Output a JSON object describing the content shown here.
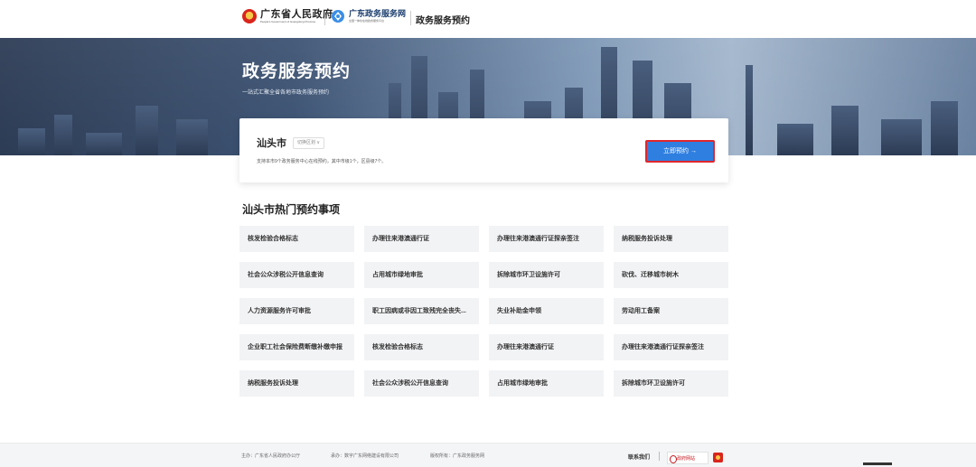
{
  "header": {
    "gov_name": "广东省人民政府",
    "gov_name_en": "People's Government of Guangdong Province",
    "portal_name": "广东政务服务网",
    "portal_sub": "全国一体化在线政务服务平台",
    "site_name": "政务服务预约"
  },
  "banner": {
    "title": "政务服务预约",
    "subtitle": "一站式汇聚全省各地市政务服务预约"
  },
  "city_card": {
    "city": "汕头市",
    "switch_label": "切换区划 ∨",
    "description": "支持本市9个政务服务中心在线预约，其中市级1个，区县级7个。",
    "book_button": "立即预约  →"
  },
  "hot_section": {
    "title": "汕头市热门预约事项",
    "items": [
      "核发检验合格标志",
      "办理往来港澳通行证",
      "办理往来港澳通行证探亲签注",
      "纳税服务投诉处理",
      "社会公众涉税公开信息查询",
      "占用城市绿地审批",
      "拆除城市环卫设施许可",
      "砍伐、迁移城市树木",
      "人力资源服务许可审批",
      "职工因病或非因工致残完全丧失...",
      "失业补助金申领",
      "劳动用工备案",
      "企业职工社会保险费断缴补缴申报",
      "核发检验合格标志",
      "办理往来港澳通行证",
      "办理往来港澳通行证探亲签注",
      "纳税服务投诉处理",
      "社会公众涉税公开信息查询",
      "占用城市绿地审批",
      "拆除城市环卫设施许可"
    ]
  },
  "footer": {
    "sponsor": "主办：广东省人民政府办公厅",
    "builder": "承办：数字广东网络建设有限公司",
    "copyright": "版权所有：广东政务服务网",
    "contact": "联系我们",
    "gov_site_badge": "政府网站"
  }
}
